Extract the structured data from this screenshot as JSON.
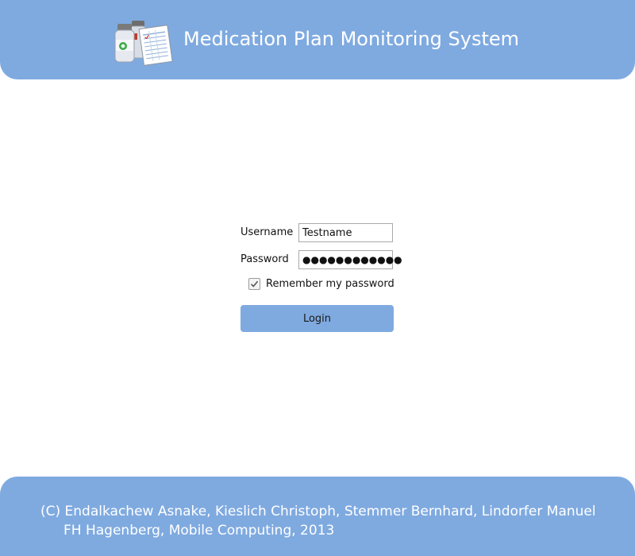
{
  "header": {
    "title": "Medication Plan Monitoring System",
    "logo_icon": "medication-bottles-and-plan-icon"
  },
  "login": {
    "username_label": "Username",
    "username_value": "Testname",
    "password_label": "Password",
    "password_value": "●●●●●●●●●●●●",
    "remember_label": "Remember my password",
    "remember_checked": true,
    "login_button_label": "Login"
  },
  "footer": {
    "line1": "(C) Endalkachew Asnake, Kieslich Christoph, Stemmer Bernhard, Lindorfer Manuel",
    "line2": "FH Hagenberg, Mobile Computing, 2013"
  },
  "colors": {
    "accent": "#7faae0",
    "background": "#ffffff"
  }
}
